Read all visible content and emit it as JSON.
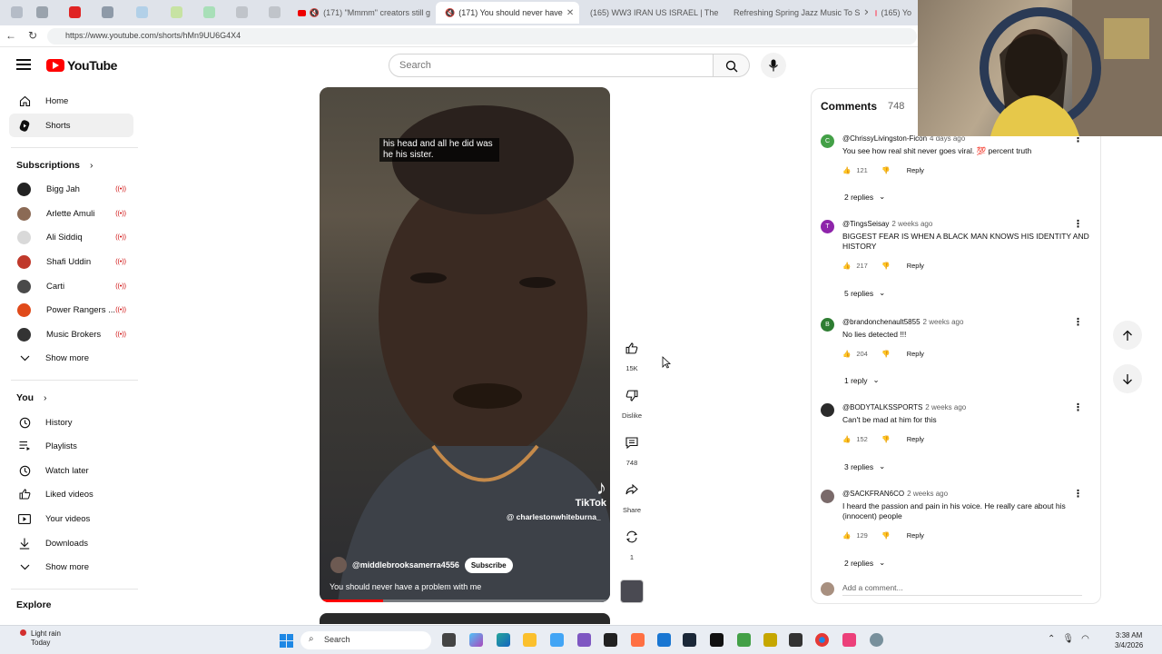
{
  "browser": {
    "tabs": [
      {
        "label": ""
      },
      {
        "label": ""
      },
      {
        "label": ""
      },
      {
        "label": ""
      },
      {
        "label": "(171) \"Mmmm\" creators still g"
      },
      {
        "label": "(171) You should never have"
      },
      {
        "label": "(165) WW3 IRAN US ISRAEL | The"
      },
      {
        "label": "Refreshing Spring Jazz Music To S"
      },
      {
        "label": "(165) Yo"
      }
    ],
    "url": "https://www.youtube.com/shorts/hMn9UU6G4X4"
  },
  "header": {
    "logo_text": "YouTube",
    "search_placeholder": "Search"
  },
  "sidebar": {
    "main": [
      {
        "label": "Home",
        "icon": "home-icon"
      },
      {
        "label": "Shorts",
        "icon": "shorts-icon"
      }
    ],
    "subscriptions_title": "Subscriptions",
    "subscriptions": [
      {
        "label": "Bigg Jah",
        "color": "#222222"
      },
      {
        "label": "Arlette Amuli",
        "color": "#8b6a55"
      },
      {
        "label": "Ali Siddiq",
        "color": "#d9d9d9"
      },
      {
        "label": "Shafi Uddin",
        "color": "#c0392b"
      },
      {
        "label": "Carti",
        "color": "#4a4a4a"
      },
      {
        "label": "Power Rangers ...",
        "color": "#e04a1a"
      },
      {
        "label": "Music Brokers",
        "color": "#333333"
      }
    ],
    "show_more": "Show more",
    "you_title": "You",
    "you_items": [
      {
        "label": "History",
        "icon": "history-icon"
      },
      {
        "label": "Playlists",
        "icon": "playlists-icon"
      },
      {
        "label": "Watch later",
        "icon": "watch-later-icon"
      },
      {
        "label": "Liked videos",
        "icon": "liked-videos-icon"
      },
      {
        "label": "Your videos",
        "icon": "your-videos-icon"
      },
      {
        "label": "Downloads",
        "icon": "downloads-icon"
      }
    ],
    "show_more_2": "Show more",
    "explore_title": "Explore"
  },
  "video": {
    "caption": "his head and all he did was he his sister.",
    "tiktok_label": "TikTok",
    "tiktok_handle": "@ charlestonwhiteburna_",
    "channel": "@middlebrooksamerra4556",
    "subscribe": "Subscribe",
    "title": "You should never have a problem with me"
  },
  "actions": {
    "likes": "15K",
    "dislike": "Dislike",
    "comments": "748",
    "share": "Share",
    "remix": "1"
  },
  "comments": {
    "title": "Comments",
    "count": "748",
    "items": [
      {
        "initial": "C",
        "color": "#43a047",
        "author": "@ChrissyLivingston-Ficon",
        "date": "4 days ago",
        "text": "You see how real shit never goes viral. 💯 percent truth",
        "likes": "121",
        "replies": "2 replies"
      },
      {
        "initial": "T",
        "color": "#8e24aa",
        "author": "@TingsSeisay",
        "date": "2 weeks ago",
        "text": "BIGGEST FEAR IS WHEN A BLACK MAN KNOWS HIS IDENTITY AND HISTORY",
        "likes": "217",
        "replies": "5 replies"
      },
      {
        "initial": "B",
        "color": "#2e7d32",
        "author": "@brandonchenault5855",
        "date": "2 weeks ago",
        "text": "No lies detected !!!",
        "likes": "204",
        "replies": "1 reply"
      },
      {
        "initial": "",
        "color": "#2b2b2b",
        "author": "@BODYTALKSSPORTS",
        "date": "2 weeks ago",
        "text": "Can't be mad at him for this",
        "likes": "152",
        "replies": "3 replies"
      },
      {
        "initial": "",
        "color": "#7a6a6a",
        "author": "@SACKFRAN6CO",
        "date": "2 weeks ago",
        "text": "I heard the passion and pain in his voice. He really care about his (innocent) people",
        "likes": "129",
        "replies": "2 replies"
      }
    ],
    "reply_label": "Reply",
    "add_placeholder": "Add a comment..."
  },
  "taskbar": {
    "weather_line1": "Light rain",
    "weather_line2": "Today",
    "search": "Search",
    "time": "3:38 AM",
    "date": "3/4/2026"
  }
}
